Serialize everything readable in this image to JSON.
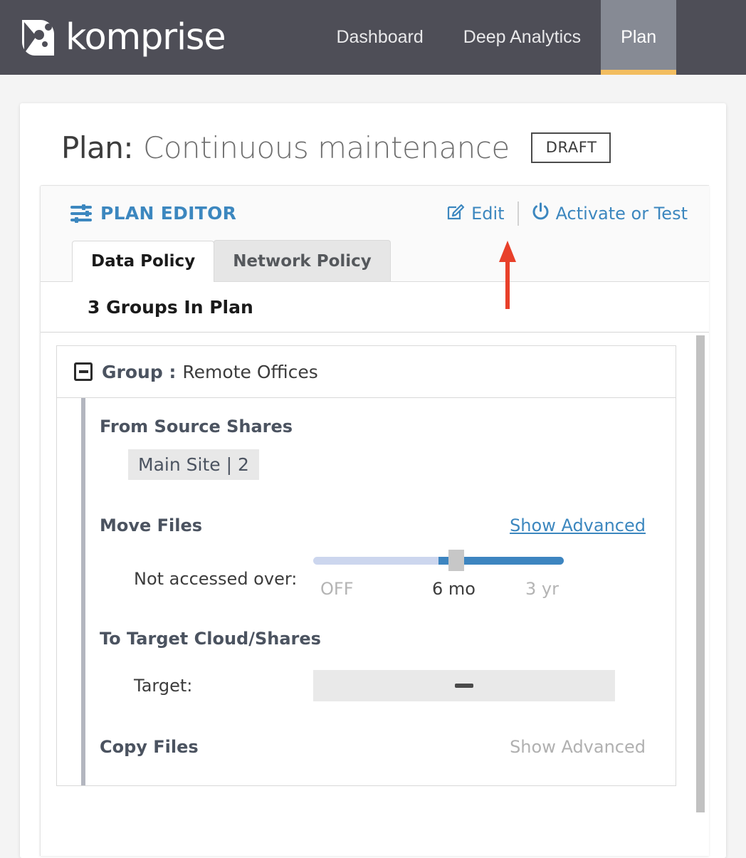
{
  "nav": {
    "brand_name": "komprise",
    "logo_icon": "komprise-k-logo-icon",
    "links": [
      {
        "label": "Dashboard",
        "active": false
      },
      {
        "label": "Deep Analytics",
        "active": false
      },
      {
        "label": "Plan",
        "active": true
      }
    ],
    "active_underline_color": "#f2bd5f",
    "background_color": "#4e4e57",
    "active_tab_background": "#868a94"
  },
  "page": {
    "plan_label": "Plan:",
    "plan_name": "Continuous maintenance",
    "status_badge": "DRAFT"
  },
  "editor": {
    "icon": "sliders-icon",
    "title": "PLAN EDITOR",
    "accent_color": "#3c87bf",
    "actions": [
      {
        "label": "Edit",
        "icon": "pencil-square-icon"
      },
      {
        "label": "Activate or Test",
        "icon": "power-icon"
      }
    ],
    "tabs": [
      {
        "label": "Data Policy",
        "active": true
      },
      {
        "label": "Network Policy",
        "active": false
      }
    ],
    "groups_count_text": "3 Groups In Plan"
  },
  "group": {
    "collapse_icon": "minus-square-icon",
    "label": "Group :",
    "name": "Remote Offices",
    "source_section": {
      "title": "From Source Shares",
      "chips": [
        "Main Site | 2"
      ]
    },
    "move_section": {
      "title": "Move Files",
      "advanced_link": "Show Advanced",
      "advanced_enabled": true,
      "slider_label": "Not accessed over:",
      "slider": {
        "min_label": "OFF",
        "value_label": "6 mo",
        "max_label": "3 yr",
        "value_percent": 54,
        "track_left_color": "#ccd6ee",
        "track_right_color": "#3d85c0",
        "handle_color": "#c7c7c7"
      }
    },
    "target_section": {
      "title": "To Target Cloud/Shares",
      "field_label": "Target:",
      "field_value": "—"
    },
    "copy_section": {
      "title": "Copy Files",
      "advanced_link": "Show Advanced",
      "advanced_enabled": false
    }
  },
  "annotation": {
    "arrow_color": "#e8402a",
    "points_to": "edit-button"
  }
}
